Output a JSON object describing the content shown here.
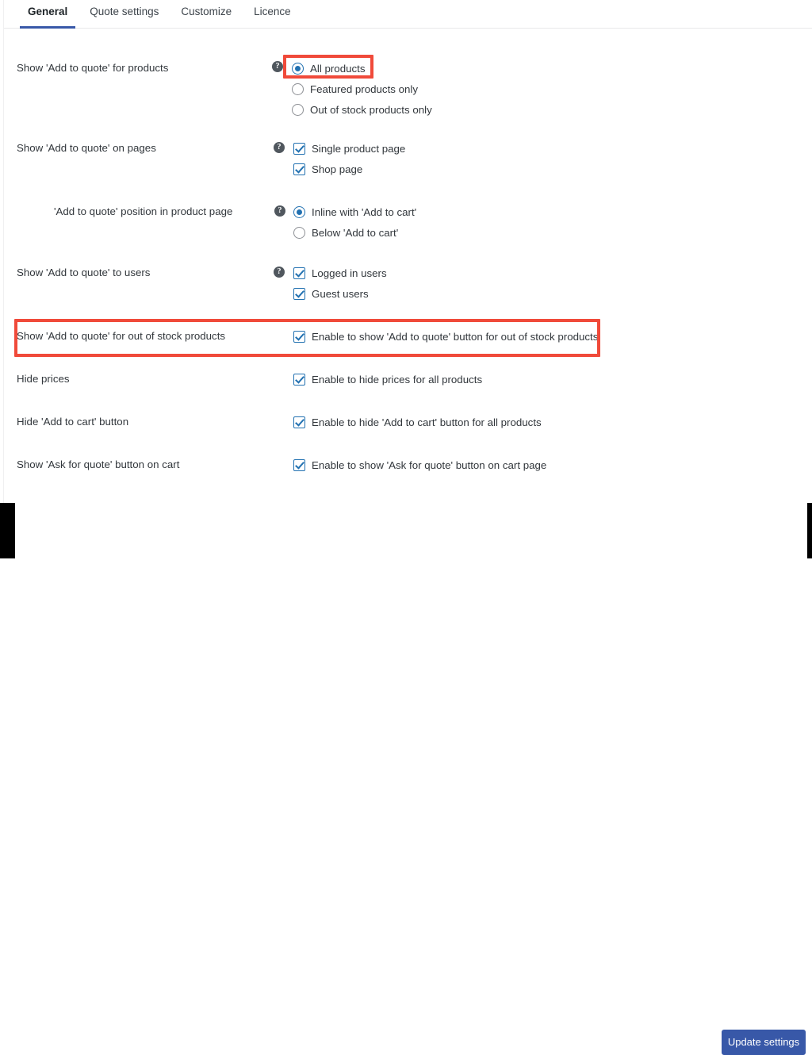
{
  "tabs": [
    {
      "label": "General",
      "active": true
    },
    {
      "label": "Quote settings",
      "active": false
    },
    {
      "label": "Customize",
      "active": false
    },
    {
      "label": "Licence",
      "active": false
    }
  ],
  "help_icon_glyph": "?",
  "settings": [
    {
      "label": "Show 'Add to quote' for products",
      "has_help": true,
      "control_type": "radio",
      "options": [
        {
          "label": "All products",
          "checked": true
        },
        {
          "label": "Featured products only",
          "checked": false
        },
        {
          "label": "Out of stock products only",
          "checked": false
        }
      ]
    },
    {
      "label": "Show 'Add to quote' on pages",
      "has_help": true,
      "control_type": "checkbox",
      "options": [
        {
          "label": "Single product page",
          "checked": true
        },
        {
          "label": "Shop page",
          "checked": true
        }
      ]
    },
    {
      "label": "'Add to quote' position in product page",
      "has_help": true,
      "control_type": "radio",
      "options": [
        {
          "label": "Inline with 'Add to cart'",
          "checked": true
        },
        {
          "label": "Below 'Add to cart'",
          "checked": false
        }
      ]
    },
    {
      "label": "Show 'Add to quote' to users",
      "has_help": true,
      "control_type": "checkbox",
      "options": [
        {
          "label": "Logged in users",
          "checked": true
        },
        {
          "label": "Guest users",
          "checked": true
        }
      ]
    },
    {
      "label": "Show 'Add to quote' for out of stock products",
      "has_help": false,
      "control_type": "checkbox",
      "options": [
        {
          "label": "Enable to show 'Add to quote' button for out of stock products",
          "checked": true
        }
      ]
    },
    {
      "label": "Hide prices",
      "has_help": false,
      "control_type": "checkbox",
      "options": [
        {
          "label": "Enable to hide prices for all products",
          "checked": true
        }
      ]
    },
    {
      "label": "Hide 'Add to cart' button",
      "has_help": false,
      "control_type": "checkbox",
      "options": [
        {
          "label": "Enable to hide 'Add to cart' button for all products",
          "checked": true
        }
      ]
    },
    {
      "label": "Show 'Ask for quote' button on cart",
      "has_help": false,
      "control_type": "checkbox",
      "options": [
        {
          "label": "Enable to show 'Ask for quote' button on cart page",
          "checked": true
        }
      ]
    }
  ],
  "footer": {
    "submit_label": "Update settings"
  },
  "colors": {
    "accent_blue": "#3858a8",
    "control_blue": "#2271b1",
    "highlight_red": "#f04a3a"
  }
}
